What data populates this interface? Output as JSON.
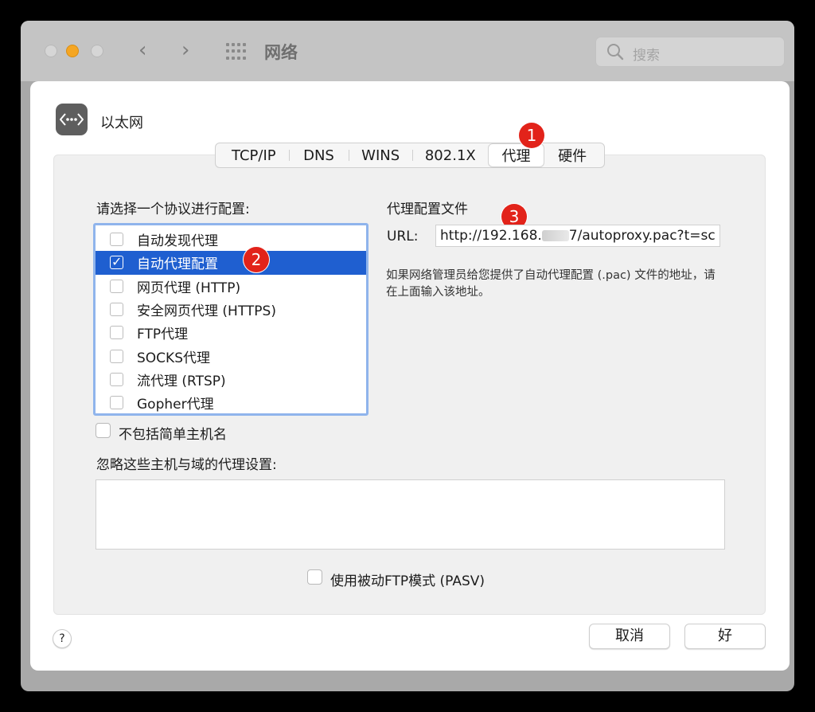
{
  "window": {
    "title": "网络",
    "search_placeholder": "搜索"
  },
  "interface": {
    "name": "以太网"
  },
  "tabs": [
    {
      "label": "TCP/IP"
    },
    {
      "label": "DNS"
    },
    {
      "label": "WINS"
    },
    {
      "label": "802.1X"
    },
    {
      "label": "代理",
      "selected": true
    },
    {
      "label": "硬件"
    }
  ],
  "badges": [
    "1",
    "2",
    "3"
  ],
  "protocols": {
    "heading": "请选择一个协议进行配置:",
    "items": [
      {
        "label": "自动发现代理",
        "checked": false
      },
      {
        "label": "自动代理配置",
        "checked": true
      },
      {
        "label": "网页代理 (HTTP)",
        "checked": false
      },
      {
        "label": "安全网页代理 (HTTPS)",
        "checked": false
      },
      {
        "label": "FTP代理",
        "checked": false
      },
      {
        "label": "SOCKS代理",
        "checked": false
      },
      {
        "label": "流代理 (RTSP)",
        "checked": false
      },
      {
        "label": "Gopher代理",
        "checked": false
      }
    ]
  },
  "pac": {
    "heading": "代理配置文件",
    "url_label": "URL:",
    "url_prefix": "http://192.168.",
    "url_suffix": "7/autoproxy.pac?t=sc",
    "description": "如果网络管理员给您提供了自动代理配置 (.pac) 文件的地址，请在上面输入该地址。"
  },
  "exclude_simple": {
    "label": "不包括简单主机名",
    "checked": false
  },
  "bypass": {
    "label": "忽略这些主机与域的代理设置:",
    "value": ""
  },
  "passive_ftp": {
    "label": "使用被动FTP模式 (PASV)",
    "checked": false
  },
  "buttons": {
    "help": "?",
    "cancel": "取消",
    "ok": "好"
  },
  "colors": {
    "selection": "#1f5fd0",
    "list_focus_ring": "#8fb4ec",
    "badge": "#e2231a",
    "minimize_light": "#f5a623"
  }
}
